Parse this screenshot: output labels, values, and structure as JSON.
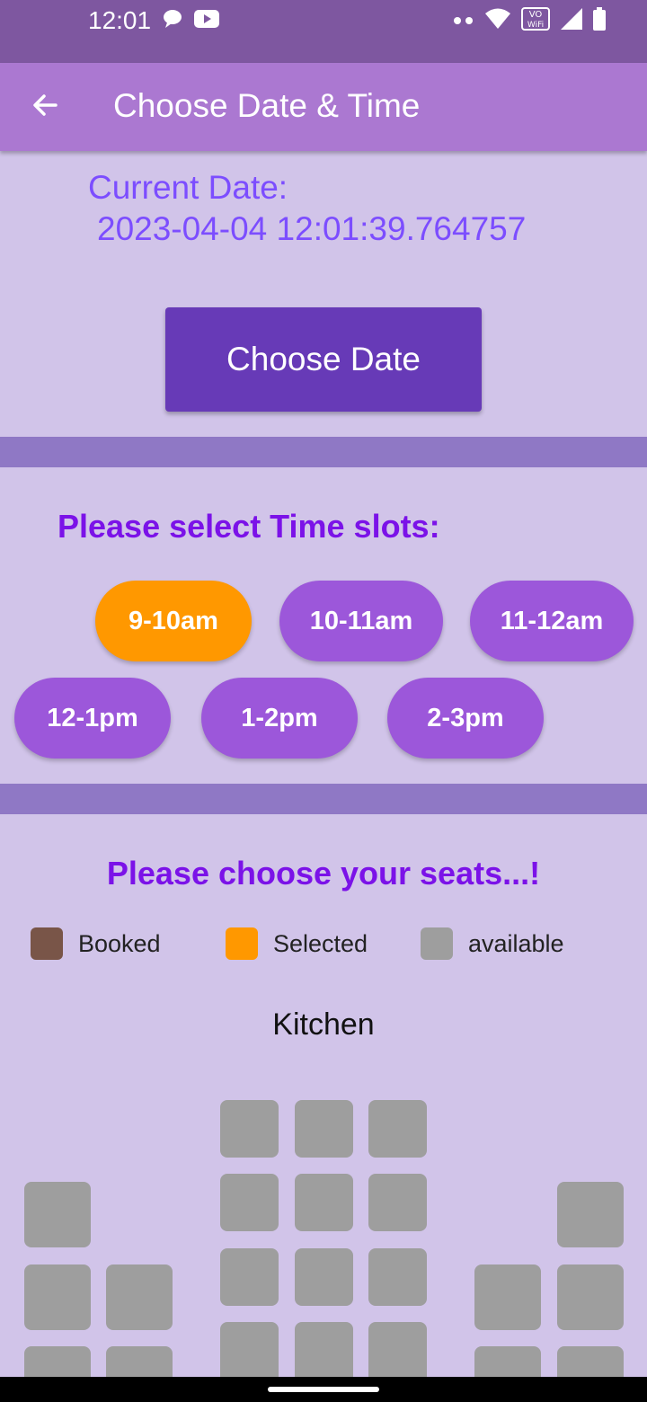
{
  "status_bar": {
    "time": "12:01",
    "wifi_badge_top": "VO",
    "wifi_badge_bottom": "WiFi"
  },
  "app_bar": {
    "title": "Choose Date & Time"
  },
  "current_date": {
    "label": "Current Date:",
    "value": "2023-04-04 12:01:39.764757"
  },
  "choose_date_button": {
    "label": "Choose Date"
  },
  "time_section": {
    "title": "Please select Time slots:",
    "slots": [
      {
        "label": "9-10am",
        "selected": true
      },
      {
        "label": "10-11am",
        "selected": false
      },
      {
        "label": "11-12am",
        "selected": false
      },
      {
        "label": "12-1pm",
        "selected": false
      },
      {
        "label": "1-2pm",
        "selected": false
      },
      {
        "label": "2-3pm",
        "selected": false
      }
    ]
  },
  "seat_section": {
    "title": "Please choose your seats...!",
    "legend": [
      {
        "label": "Booked",
        "color": "#795548"
      },
      {
        "label": "Selected",
        "color": "#ff9800"
      },
      {
        "label": "available",
        "color": "#9e9e9e"
      }
    ],
    "area_label": "Kitchen"
  },
  "colors": {
    "status_bar": "#7e57a0",
    "app_bar": "#ab78d1",
    "background": "#d1c4e9",
    "button": "#673ab7",
    "divider": "#8f78c5",
    "slot": "#9c57da",
    "slot_selected": "#ff9800",
    "accent_text": "#7c4dff",
    "section_title": "#7b12e8",
    "seat_available": "#9e9e9e"
  }
}
